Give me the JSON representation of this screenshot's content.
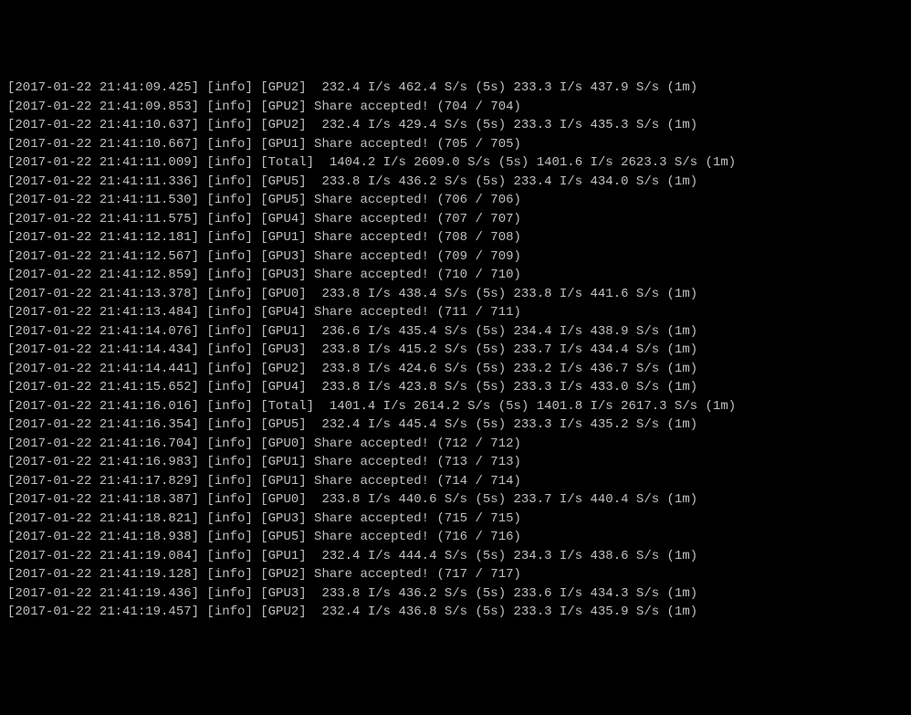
{
  "lines": [
    "[2017-01-22 21:41:09.425] [info] [GPU2]  232.4 I/s 462.4 S/s (5s) 233.3 I/s 437.9 S/s (1m)",
    "[2017-01-22 21:41:09.853] [info] [GPU2] Share accepted! (704 / 704)",
    "[2017-01-22 21:41:10.637] [info] [GPU2]  232.4 I/s 429.4 S/s (5s) 233.3 I/s 435.3 S/s (1m)",
    "[2017-01-22 21:41:10.667] [info] [GPU1] Share accepted! (705 / 705)",
    "[2017-01-22 21:41:11.009] [info] [Total]  1404.2 I/s 2609.0 S/s (5s) 1401.6 I/s 2623.3 S/s (1m)",
    "[2017-01-22 21:41:11.336] [info] [GPU5]  233.8 I/s 436.2 S/s (5s) 233.4 I/s 434.0 S/s (1m)",
    "[2017-01-22 21:41:11.530] [info] [GPU5] Share accepted! (706 / 706)",
    "[2017-01-22 21:41:11.575] [info] [GPU4] Share accepted! (707 / 707)",
    "[2017-01-22 21:41:12.181] [info] [GPU1] Share accepted! (708 / 708)",
    "[2017-01-22 21:41:12.567] [info] [GPU3] Share accepted! (709 / 709)",
    "[2017-01-22 21:41:12.859] [info] [GPU3] Share accepted! (710 / 710)",
    "[2017-01-22 21:41:13.378] [info] [GPU0]  233.8 I/s 438.4 S/s (5s) 233.8 I/s 441.6 S/s (1m)",
    "[2017-01-22 21:41:13.484] [info] [GPU4] Share accepted! (711 / 711)",
    "[2017-01-22 21:41:14.076] [info] [GPU1]  236.6 I/s 435.4 S/s (5s) 234.4 I/s 438.9 S/s (1m)",
    "[2017-01-22 21:41:14.434] [info] [GPU3]  233.8 I/s 415.2 S/s (5s) 233.7 I/s 434.4 S/s (1m)",
    "[2017-01-22 21:41:14.441] [info] [GPU2]  233.8 I/s 424.6 S/s (5s) 233.2 I/s 436.7 S/s (1m)",
    "[2017-01-22 21:41:15.652] [info] [GPU4]  233.8 I/s 423.8 S/s (5s) 233.3 I/s 433.0 S/s (1m)",
    "[2017-01-22 21:41:16.016] [info] [Total]  1401.4 I/s 2614.2 S/s (5s) 1401.8 I/s 2617.3 S/s (1m)",
    "[2017-01-22 21:41:16.354] [info] [GPU5]  232.4 I/s 445.4 S/s (5s) 233.3 I/s 435.2 S/s (1m)",
    "[2017-01-22 21:41:16.704] [info] [GPU0] Share accepted! (712 / 712)",
    "[2017-01-22 21:41:16.983] [info] [GPU1] Share accepted! (713 / 713)",
    "[2017-01-22 21:41:17.829] [info] [GPU1] Share accepted! (714 / 714)",
    "[2017-01-22 21:41:18.387] [info] [GPU0]  233.8 I/s 440.6 S/s (5s) 233.7 I/s 440.4 S/s (1m)",
    "[2017-01-22 21:41:18.821] [info] [GPU3] Share accepted! (715 / 715)",
    "[2017-01-22 21:41:18.938] [info] [GPU5] Share accepted! (716 / 716)",
    "[2017-01-22 21:41:19.084] [info] [GPU1]  232.4 I/s 444.4 S/s (5s) 234.3 I/s 438.6 S/s (1m)",
    "[2017-01-22 21:41:19.128] [info] [GPU2] Share accepted! (717 / 717)",
    "[2017-01-22 21:41:19.436] [info] [GPU3]  233.8 I/s 436.2 S/s (5s) 233.6 I/s 434.3 S/s (1m)",
    "[2017-01-22 21:41:19.457] [info] [GPU2]  232.4 I/s 436.8 S/s (5s) 233.3 I/s 435.9 S/s (1m)"
  ]
}
